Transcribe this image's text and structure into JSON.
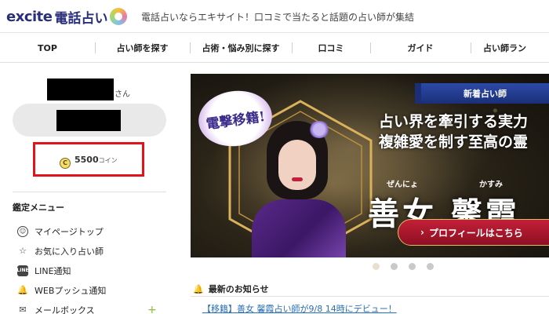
{
  "header": {
    "logo_word": "excite",
    "logo_service": "電話占い",
    "tagline": "電話占いならエキサイト！口コミで当たると話題の占い師が集結"
  },
  "nav": {
    "items": [
      "TOP",
      "占い師を探す",
      "占術・悩み別に探す",
      "口コミ",
      "ガイド",
      "占い師ラン"
    ]
  },
  "user": {
    "honorific": "さん",
    "coins": "5500",
    "coin_unit": "コイン",
    "coin_symbol": "C"
  },
  "menu": {
    "title": "鑑定メニュー",
    "items": [
      {
        "icon": "user-circle-icon",
        "glyph": "☺",
        "label": "マイページトップ"
      },
      {
        "icon": "star-icon",
        "glyph": "☆",
        "label": "お気に入り占い師"
      },
      {
        "icon": "line-icon",
        "glyph": "LINE",
        "label": "LINE通知"
      },
      {
        "icon": "bell-icon",
        "glyph": "🔔",
        "label": "WEBプッシュ通知"
      },
      {
        "icon": "mail-icon",
        "glyph": "✉",
        "label": "メールボックス"
      }
    ]
  },
  "banner": {
    "badge": "電撃移籍!",
    "ribbon": "新着占い師",
    "catch_line1": "占い界を牽引する実力",
    "catch_line2": "複雑愛を制す至高の霊",
    "ruby1": "ぜんにょ",
    "ruby2": "かすみ",
    "name": "善女 馨霞",
    "profile_button": "プロフィールはこちら"
  },
  "news": {
    "title": "最新のお知らせ",
    "item": "【移籍】善女 馨霞占い師が9/8 14時にデビュー！"
  },
  "colors": {
    "accent": "#2a2f7a",
    "highlight_border": "#e3131b",
    "link": "#2a6fb8",
    "button": "#c22038"
  }
}
